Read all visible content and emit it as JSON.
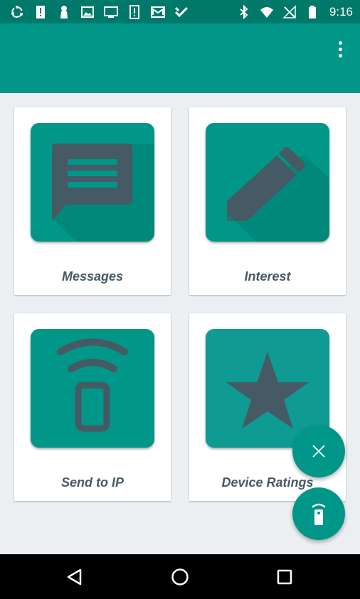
{
  "status_bar": {
    "time": "9:16",
    "left_icons": [
      "sync-icon",
      "alert-icon",
      "person-icon",
      "image-icon",
      "cast-icon",
      "alert-icon",
      "mail-icon",
      "check-icon"
    ],
    "right_icons": [
      "bluetooth-icon",
      "wifi-icon",
      "no-signal-icon",
      "battery-icon"
    ]
  },
  "app_bar": {
    "menu_icon": "more-vert-icon"
  },
  "grid": {
    "items": [
      {
        "label": "Messages",
        "icon": "message-icon"
      },
      {
        "label": "Interest",
        "icon": "pencil-icon"
      },
      {
        "label": "Send to IP",
        "icon": "phone-signal-icon"
      },
      {
        "label": "Device Ratings",
        "icon": "star-icon"
      }
    ]
  },
  "fabs": {
    "close_icon": "close-icon",
    "remote_icon": "remote-icon"
  },
  "nav_bar": {
    "back_icon": "back-icon",
    "home_icon": "home-icon",
    "recents_icon": "recents-icon"
  },
  "colors": {
    "status_bar": "#00796b",
    "app_bar": "#009688",
    "tile": "#009688",
    "icon_dark": "#455a64",
    "label": "#455a64",
    "background": "#eceff1"
  }
}
